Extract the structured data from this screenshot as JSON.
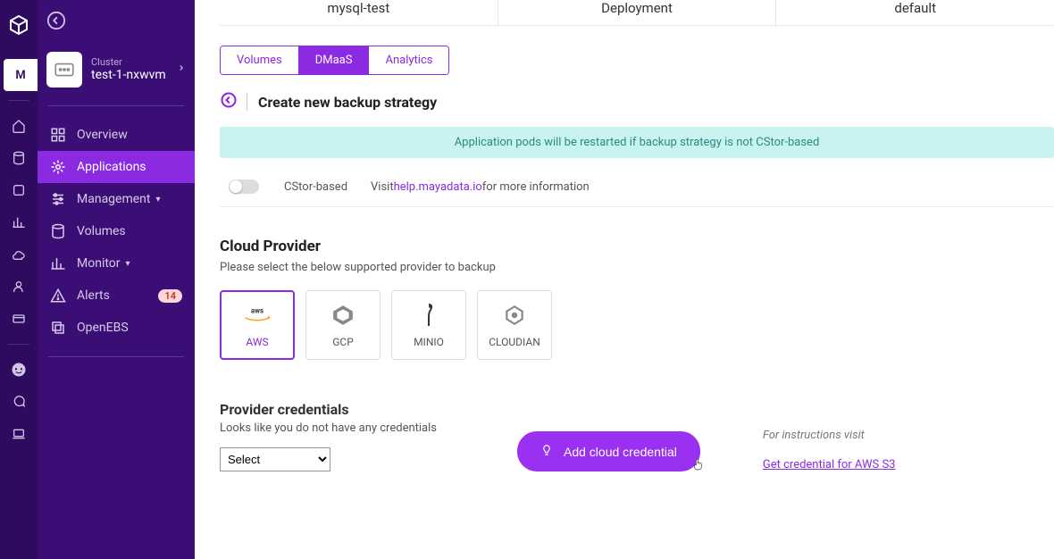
{
  "rail": {
    "active_letter": "M"
  },
  "sidebar": {
    "cluster_label": "Cluster",
    "cluster_name": "test-1-nxwvm",
    "items": [
      {
        "label": "Overview"
      },
      {
        "label": "Applications"
      },
      {
        "label": "Management"
      },
      {
        "label": "Volumes"
      },
      {
        "label": "Monitor"
      },
      {
        "label": "Alerts",
        "badge": "14"
      },
      {
        "label": "OpenEBS"
      }
    ]
  },
  "crumbs": {
    "app": "mysql-test",
    "kind": "Deployment",
    "ns": "default"
  },
  "tabs": [
    {
      "label": "Volumes"
    },
    {
      "label": "DMaaS"
    },
    {
      "label": "Analytics"
    }
  ],
  "page_title": "Create new backup strategy",
  "banner": "Application pods will be restarted if backup strategy is not CStor-based",
  "cstor": {
    "label": "CStor-based",
    "visit": "Visit ",
    "link": "help.mayadata.io",
    "tail": " for more information"
  },
  "cloud_provider": {
    "title": "Cloud Provider",
    "sub": "Please select the below supported provider to backup",
    "options": [
      {
        "label": "AWS"
      },
      {
        "label": "GCP"
      },
      {
        "label": "MINIO"
      },
      {
        "label": "CLOUDIAN"
      }
    ]
  },
  "credentials": {
    "title": "Provider credentials",
    "sub": "Looks like you do not have any credentials",
    "select_placeholder": "Select",
    "add_button": "Add cloud credential",
    "instructions_label": "For instructions visit",
    "instructions_link": "Get credential for AWS S3"
  }
}
